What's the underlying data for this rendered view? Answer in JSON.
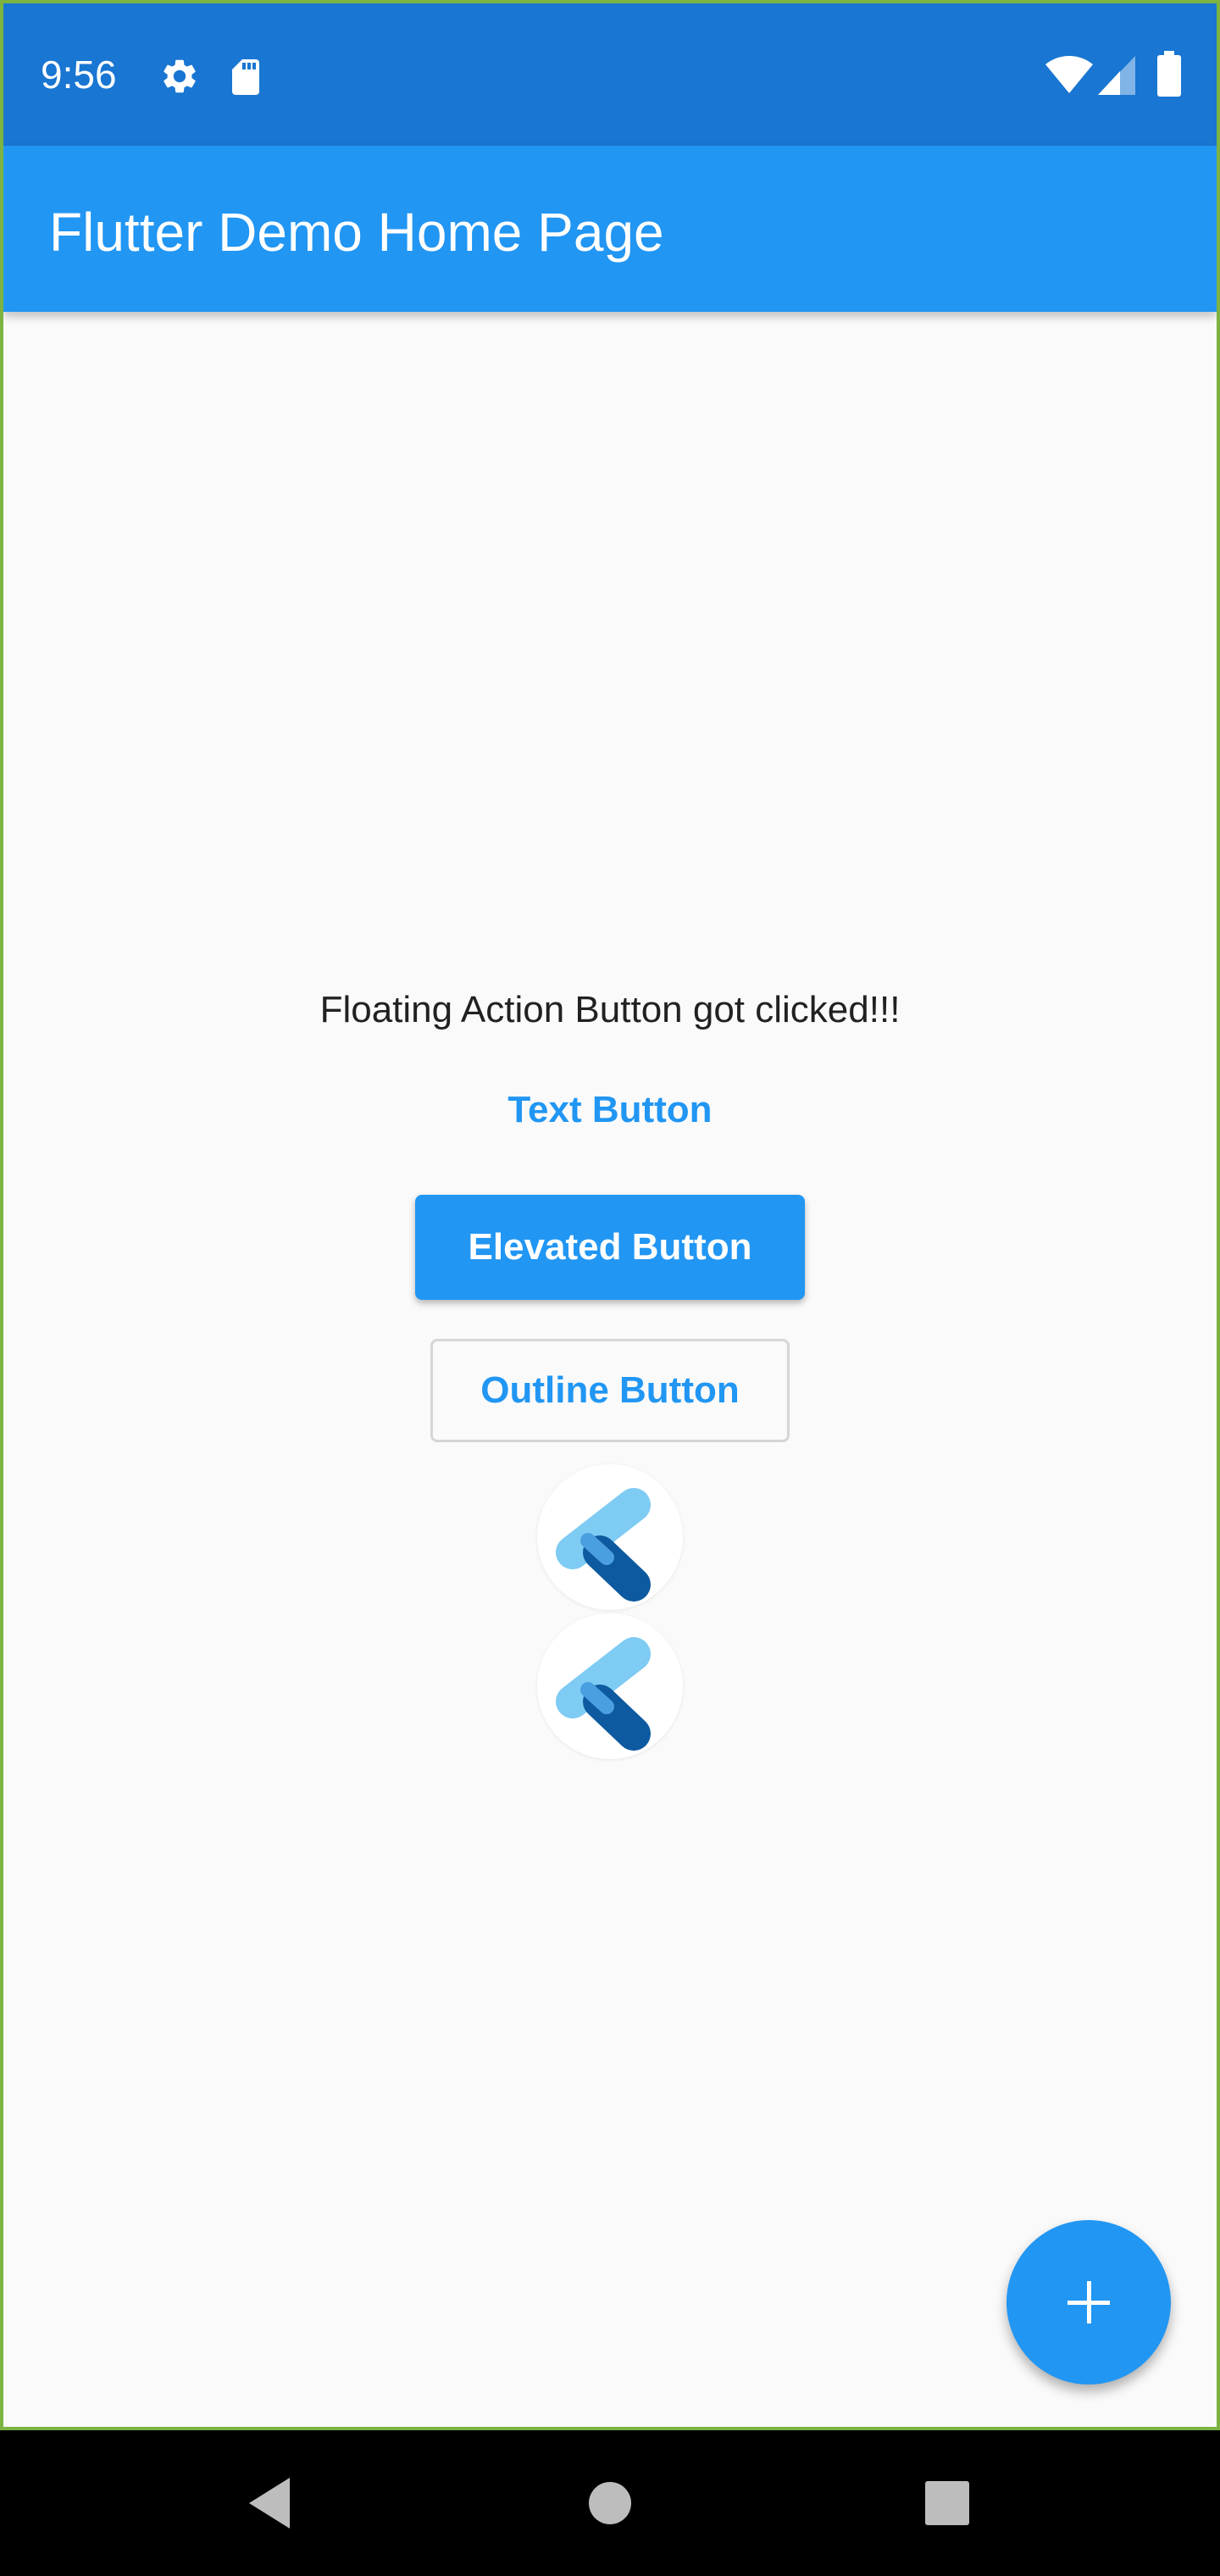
{
  "status_bar": {
    "time": "9:56",
    "icons": [
      "gear-icon",
      "sd-card-icon",
      "wifi-icon",
      "signal-icon",
      "battery-icon"
    ],
    "background_color": "#1976d2"
  },
  "app_bar": {
    "title": "Flutter Demo Home Page",
    "background_color": "#2196f3"
  },
  "main": {
    "message": "Floating Action Button got clicked!!!",
    "text_button_label": "Text Button",
    "elevated_button_label": "Elevated Button",
    "outline_button_label": "Outline Button",
    "logo_icons": [
      "flutter-logo-icon",
      "flutter-logo-icon"
    ]
  },
  "fab": {
    "icon": "plus-icon",
    "color": "#2196f3"
  },
  "nav_bar": {
    "buttons": [
      "back-icon",
      "home-icon",
      "recents-icon"
    ]
  },
  "colors": {
    "primary": "#2196f3",
    "primary_dark": "#1976d2",
    "background": "#fafafa",
    "logo_light": "#7ecbf4",
    "logo_dark": "#0d5aa0"
  }
}
